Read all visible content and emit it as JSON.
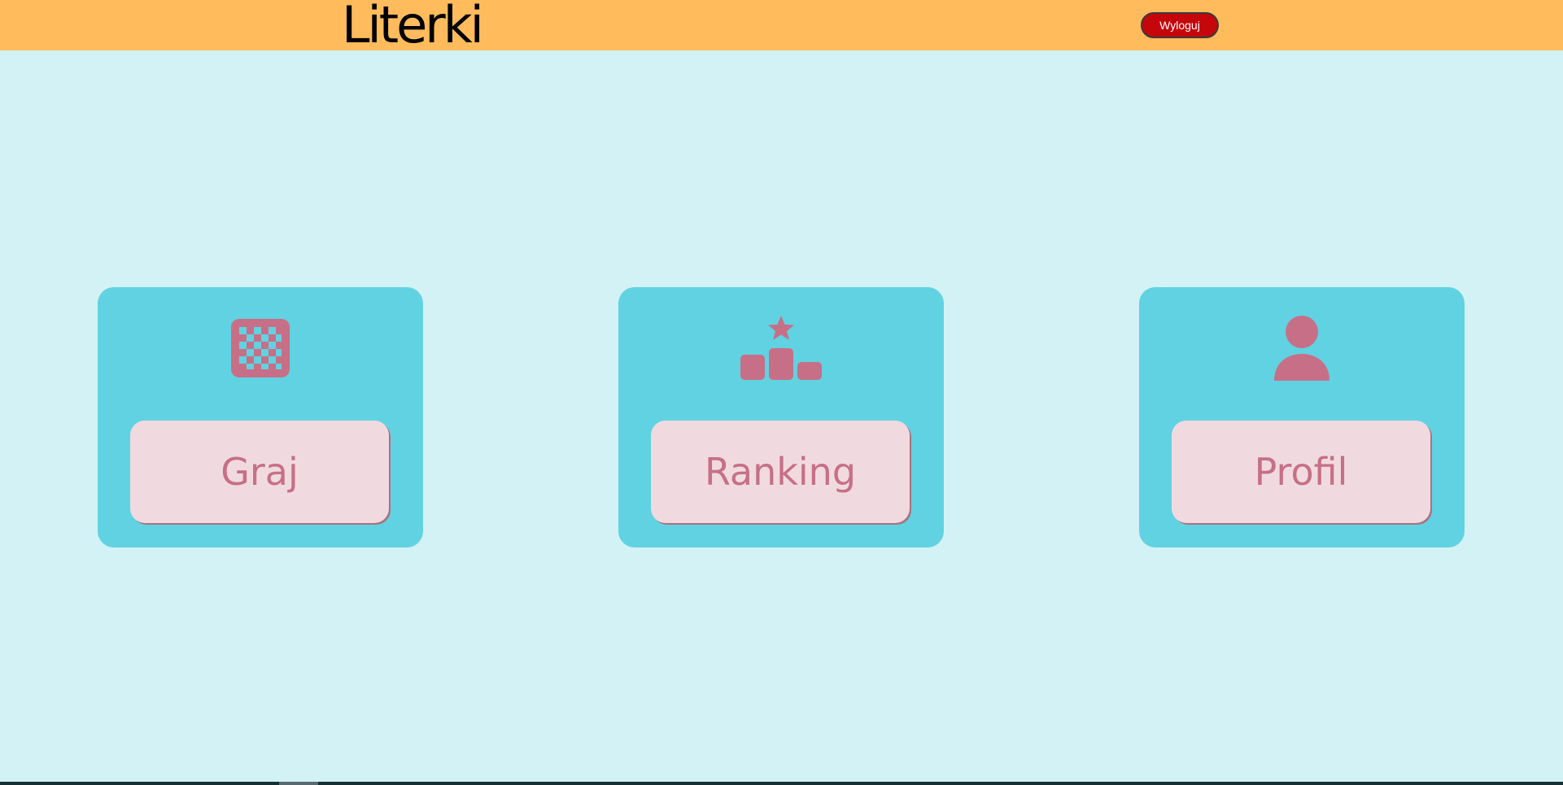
{
  "header": {
    "title": "Literki",
    "logout_label": "Wyloguj",
    "background": "#ffbb5c"
  },
  "cards": [
    {
      "label": "Graj",
      "icon": "checkerboard-icon"
    },
    {
      "label": "Ranking",
      "icon": "podium-icon"
    },
    {
      "label": "Profil",
      "icon": "user-icon"
    }
  ],
  "colors": {
    "page_background": "#d3f2f5",
    "card_background": "#61d2e1",
    "button_background": "#f0dae0",
    "accent": "#c76f87",
    "logout_button": "#c5070b"
  }
}
